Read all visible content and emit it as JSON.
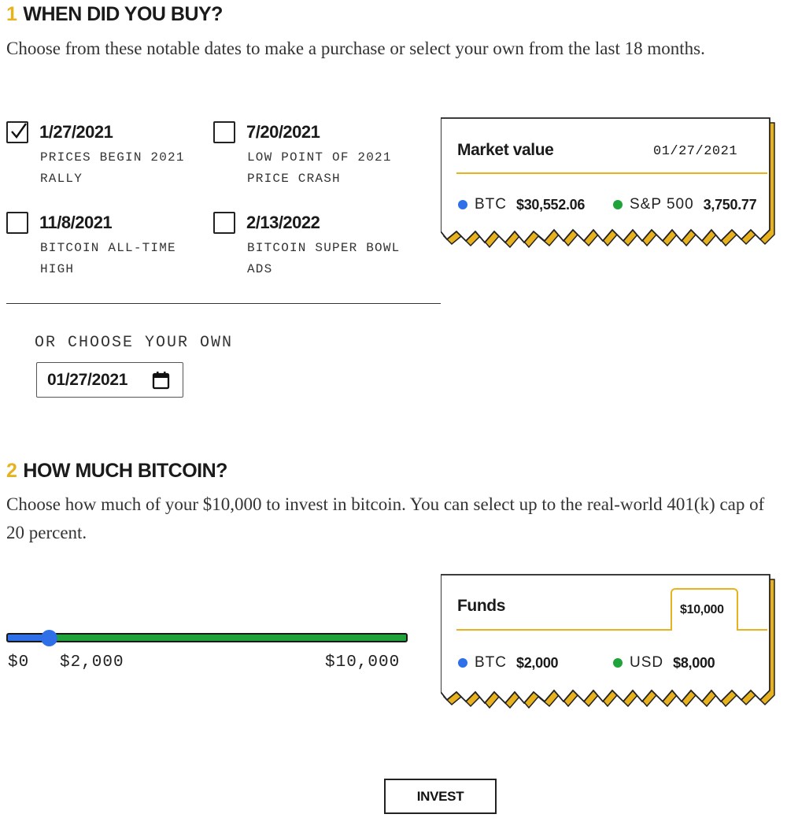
{
  "step1": {
    "number": "1",
    "heading": "WHEN DID YOU BUY?",
    "intro": "Choose from these notable dates to make a purchase or select your own from the last 18 months.",
    "options": [
      {
        "date": "1/27/2021",
        "description": "PRICES BEGIN 2021 RALLY",
        "checked": true
      },
      {
        "date": "7/20/2021",
        "description": "LOW POINT OF 2021 PRICE CRASH",
        "checked": false
      },
      {
        "date": "11/8/2021",
        "description": "BITCOIN ALL-TIME HIGH",
        "checked": false
      },
      {
        "date": "2/13/2022",
        "description": "BITCOIN SUPER BOWL ADS",
        "checked": false
      }
    ],
    "own_label": "OR CHOOSE YOUR OWN",
    "date_input_value": "01/27/2021"
  },
  "market_card": {
    "title": "Market value",
    "date": "01/27/2021",
    "btc_label": "BTC",
    "btc_value": "$30,552.06",
    "sp_label": "S&P 500",
    "sp_value": "3,750.77"
  },
  "step2": {
    "number": "2",
    "heading": "HOW MUCH BITCOIN?",
    "intro": "Choose how much of your $10,000 to invest in bitcoin. You can select up to the real-world 401(k) cap of 20 percent.",
    "slider": {
      "min_label": "$0",
      "value_label": "$2,000",
      "max_label": "$10,000",
      "value_fraction": 0.2
    }
  },
  "funds_card": {
    "title": "Funds",
    "total": "$10,000",
    "btc_label": "BTC",
    "btc_value": "$2,000",
    "usd_label": "USD",
    "usd_value": "$8,000"
  },
  "invest_label": "INVEST",
  "colors": {
    "accent": "#e8b21f",
    "btc": "#2f6fe8",
    "other": "#1fa33a"
  }
}
